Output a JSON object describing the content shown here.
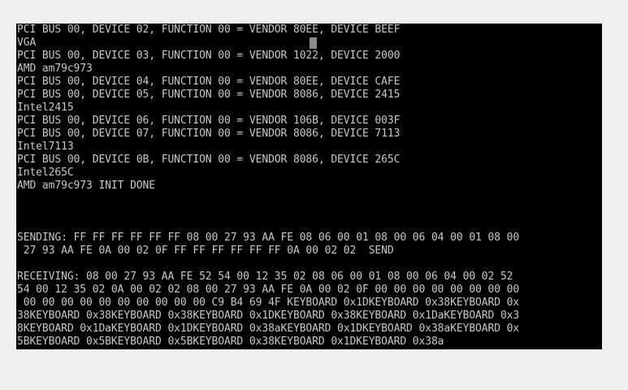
{
  "console": {
    "lines": [
      "PCI BUS 00, DEVICE 02, FUNCTION 00 = VENDOR 80EE, DEVICE BEEF",
      "VGA",
      "PCI BUS 00, DEVICE 03, FUNCTION 00 = VENDOR 1022, DEVICE 2000",
      "AMD am79c973",
      "PCI BUS 00, DEVICE 04, FUNCTION 00 = VENDOR 80EE, DEVICE CAFE",
      "PCI BUS 00, DEVICE 05, FUNCTION 00 = VENDOR 8086, DEVICE 2415",
      "Intel2415",
      "PCI BUS 00, DEVICE 06, FUNCTION 00 = VENDOR 106B, DEVICE 003F",
      "PCI BUS 00, DEVICE 07, FUNCTION 00 = VENDOR 8086, DEVICE 7113",
      "Intel7113",
      "PCI BUS 00, DEVICE 0B, FUNCTION 00 = VENDOR 8086, DEVICE 265C",
      "Intel265C",
      "AMD am79c973 INIT DONE",
      "",
      "",
      "",
      "SENDING: FF FF FF FF FF FF 08 00 27 93 AA FE 08 06 00 01 08 00 06 04 00 01 08 00",
      " 27 93 AA FE 0A 00 02 0F FF FF FF FF FF FF 0A 00 02 02  SEND",
      "",
      "RECEIVING: 08 00 27 93 AA FE 52 54 00 12 35 02 08 06 00 01 08 00 06 04 00 02 52",
      "54 00 12 35 02 0A 00 02 02 08 00 27 93 AA FE 0A 00 02 0F 00 00 00 00 00 00 00 00",
      " 00 00 00 00 00 00 00 00 00 00 C9 B4 69 4F KEYBOARD 0x1DKEYBOARD 0x38KEYBOARD 0x",
      "38KEYBOARD 0x38KEYBOARD 0x38KEYBOARD 0x1DKEYBOARD 0x38KEYBOARD 0x1DaKEYBOARD 0x3",
      "8KEYBOARD 0x1DaKEYBOARD 0x1DKEYBOARD 0x38aKEYBOARD 0x1DKEYBOARD 0x38aKEYBOARD 0x",
      "5BKEYBOARD 0x5BKEYBOARD 0x5BKEYBOARD 0x38KEYBOARD 0x1DKEYBOARD 0x38a"
    ]
  }
}
